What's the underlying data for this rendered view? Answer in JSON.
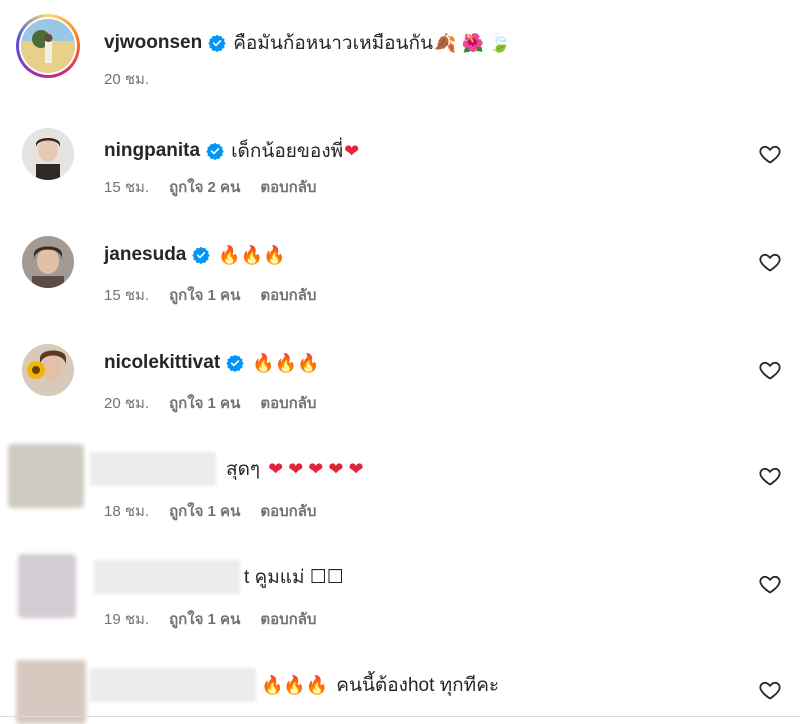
{
  "comments": [
    {
      "username": "vjwoonsen",
      "verified": true,
      "text": "คือมันก้อหนาวเหมือนกัน",
      "emoji": "🍂 🌺 🍃",
      "time": "20 ชม.",
      "likes": "",
      "reply": ""
    },
    {
      "username": "ningpanita",
      "verified": true,
      "text": "เด็กน้อยของพี่",
      "emoji": "❤",
      "time": "15 ชม.",
      "likes": "ถูกใจ 2 คน",
      "reply": "ตอบกลับ"
    },
    {
      "username": "janesuda",
      "verified": true,
      "text": "",
      "emoji": "🔥🔥🔥",
      "time": "15 ชม.",
      "likes": "ถูกใจ 1 คน",
      "reply": "ตอบกลับ"
    },
    {
      "username": "nicolekittivat",
      "verified": true,
      "text": "",
      "emoji": "🔥🔥🔥",
      "time": "20 ชม.",
      "likes": "ถูกใจ 1 คน",
      "reply": "ตอบกลับ"
    },
    {
      "username": "",
      "verified": false,
      "text": "สุดๆ",
      "emoji": "❤ ❤ ❤ ❤ ❤",
      "time": "18 ชม.",
      "likes": "ถูกใจ 1 คน",
      "reply": "ตอบกลับ"
    },
    {
      "username": "",
      "verified": false,
      "text": "t คูมแม่ ☐☐",
      "emoji": "",
      "time": "19 ชม.",
      "likes": "ถูกใจ 1 คน",
      "reply": "ตอบกลับ"
    },
    {
      "username": "",
      "verified": false,
      "text": "คนนี้ต้องhot ทุกทีคะ",
      "emoji": "🔥🔥🔥",
      "time": "",
      "likes": "",
      "reply": ""
    }
  ],
  "icons": {
    "verified": "verified-badge-icon",
    "like": "heart-outline-icon"
  },
  "colors": {
    "verified_blue": "#0095f6",
    "secondary_text": "#737373",
    "primary_text": "#262626"
  }
}
